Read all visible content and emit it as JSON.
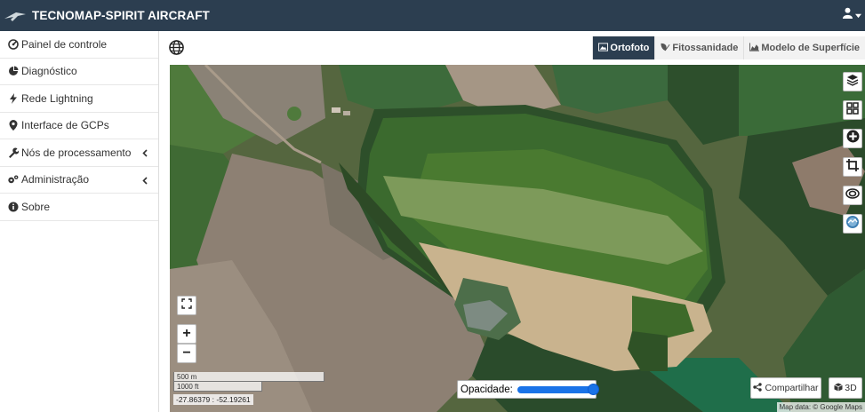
{
  "header": {
    "logo_text": "SPIRIT",
    "title": "TECNOMAP-SPIRIT AIRCRAFT",
    "user_icon": "user-icon"
  },
  "sidebar": {
    "items": [
      {
        "label": "Painel de controle",
        "icon": "dashboard-icon"
      },
      {
        "label": "Diagnóstico",
        "icon": "pie-chart-icon"
      },
      {
        "label": "Rede Lightning",
        "icon": "bolt-icon"
      },
      {
        "label": "Interface de GCPs",
        "icon": "map-marker-icon"
      },
      {
        "label": "Nós de processamento",
        "icon": "wrench-icon",
        "chevron": "‹"
      },
      {
        "label": "Administração",
        "icon": "gears-icon",
        "chevron": "‹"
      },
      {
        "label": "Sobre",
        "icon": "info-icon"
      }
    ]
  },
  "map": {
    "tabs": [
      {
        "label": "Ortofoto",
        "icon": "image-icon",
        "active": true
      },
      {
        "label": "Fitossanidade",
        "icon": "plant-icon",
        "active": false
      },
      {
        "label": "Modelo de Superfície",
        "icon": "area-chart-icon",
        "active": false
      }
    ],
    "zoom_in": "+",
    "zoom_out": "−",
    "scale_m": "500 m",
    "scale_ft": "1000 ft",
    "coords": "-27.86379 : -52.19261",
    "opacity_label": "Opacidade:",
    "opacity_value": 1.0,
    "share_label": "Compartilhar",
    "btn3d_label": "3D",
    "attribution": "Map data: © Google Maps",
    "right_controls": [
      "layers-icon",
      "grid-icon",
      "plus-circle-icon",
      "crop-icon",
      "eye-icon",
      "cesium-icon"
    ]
  },
  "colors": {
    "header_bg": "#2c3e50",
    "active_tab": "#2c3e50",
    "slider": "#1a73e8"
  }
}
